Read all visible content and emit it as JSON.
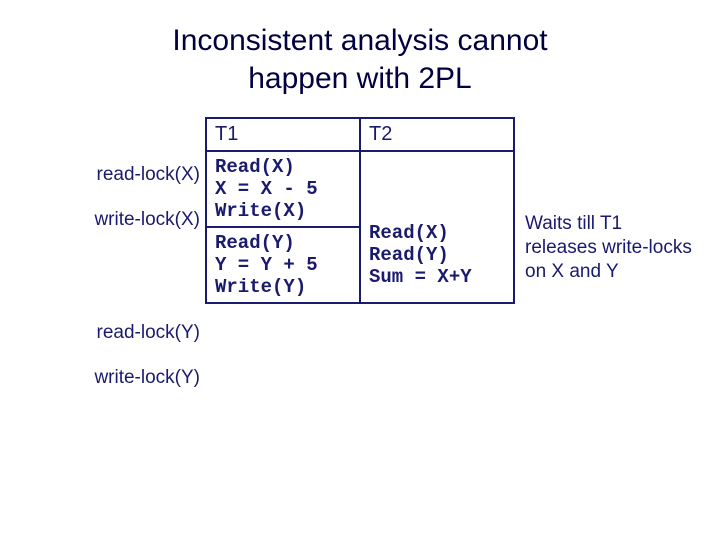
{
  "title_line1": "Inconsistent analysis cannot",
  "title_line2": "happen with 2PL",
  "headers": {
    "t1": "T1",
    "t2": "T2"
  },
  "t1_block1": "Read(X)\nX = X - 5\nWrite(X)",
  "t2_block": "\n\n\nRead(X)\nRead(Y)\nSum = X+Y",
  "t1_block2": "Read(Y)\nY = Y + 5\nWrite(Y)",
  "left": {
    "a1": "read-lock(X)",
    "a2": "write-lock(X)",
    "a3": "read-lock(Y)",
    "a4": "write-lock(Y)"
  },
  "right_note": "Waits till T1 releases write-locks on X and Y"
}
